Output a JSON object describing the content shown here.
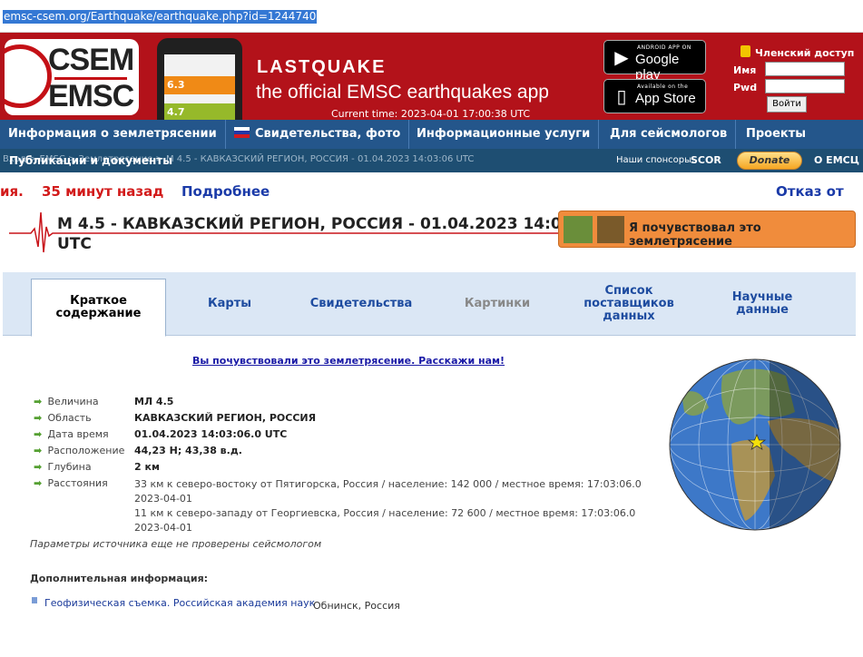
{
  "browser": {
    "url": "emsc-csem.org/Earthquake/earthquake.php?id=1244740"
  },
  "banner": {
    "logo_top": "CSEM",
    "logo_bottom": "EMSC",
    "phone_val1": "6.3",
    "phone_val2": "4.7",
    "app_title": "LASTQUAKE",
    "app_subtitle": "the official EMSC earthquakes app",
    "current_time": "Current time: 2023-04-01 17:00:38 UTC",
    "google_small": "ANDROID APP ON",
    "google_big": "Google play",
    "apple_small": "Available on the",
    "apple_big": "App Store",
    "member_access": "Членский доступ",
    "name_label": "Имя",
    "pwd_label": "Pwd",
    "login_button": "Войти"
  },
  "nav": {
    "items": [
      "Информация о землетрясении",
      "Свидетельства, фото",
      "Информационные услуги",
      "Для сейсмологов",
      "Проекты"
    ]
  },
  "breadcrumb": {
    "trail": "Вход > EMSC > Землетрясение > M 4.5 - КАВКАЗСКИЙ РЕГИОН, РОССИЯ - 01.04.2023 14:03:06 UTC",
    "overlap_item": "Публикации и документы",
    "sponsors_label": "Наши спонсоры:",
    "sponsor": "SCOR",
    "donate": "Donate",
    "about": "О ЕМСЦ"
  },
  "ticker": {
    "fragment": "ия.",
    "ago": "35 минут назад",
    "more": "Подробнее",
    "disclaimer": "Отказ от"
  },
  "event": {
    "title": "M 4.5 - КАВКАЗСКИЙ РЕГИОН, РОССИЯ - 01.04.2023 14:03:06 UTC",
    "felt_button": "Я почувствовал это землетрясение"
  },
  "tabs": {
    "summary": "Краткое содержание",
    "maps": "Карты",
    "testimonies": "Свидетельства",
    "pictures": "Картинки",
    "providers": "Список поставщиков данных",
    "scientific": "Научные данные"
  },
  "felt_link": "Вы почувствовали это землетрясение. Расскажи нам!",
  "details": {
    "magnitude_label": "Величина",
    "magnitude": "МЛ 4.5",
    "region_label": "Область",
    "region": "КАВКАЗСКИЙ РЕГИОН, РОССИЯ",
    "datetime_label": "Дата время",
    "datetime": "01.04.2023 14:03:06.0 UTC",
    "location_label": "Расположение",
    "location": "44,23 Н; 43,38 в.д.",
    "depth_label": "Глубина",
    "depth": "2 км",
    "distances_label": "Расстояния",
    "dist1": "33 км к северо-востоку от Пятигорска, Россия / население: 142 000 / местное время: 17:03:06.0 2023-04-01",
    "dist2": "11 км к северо-западу от Георгиевска, Россия / население: 72 600 / местное время: 17:03:06.0 2023-04-01"
  },
  "note": "Параметры источника еще не проверены сейсмологом",
  "additional_info": "Дополнительная информация:",
  "source": {
    "name": "Геофизическая съемка. Российская академия наук",
    "city": "Обнинск, Россия"
  }
}
